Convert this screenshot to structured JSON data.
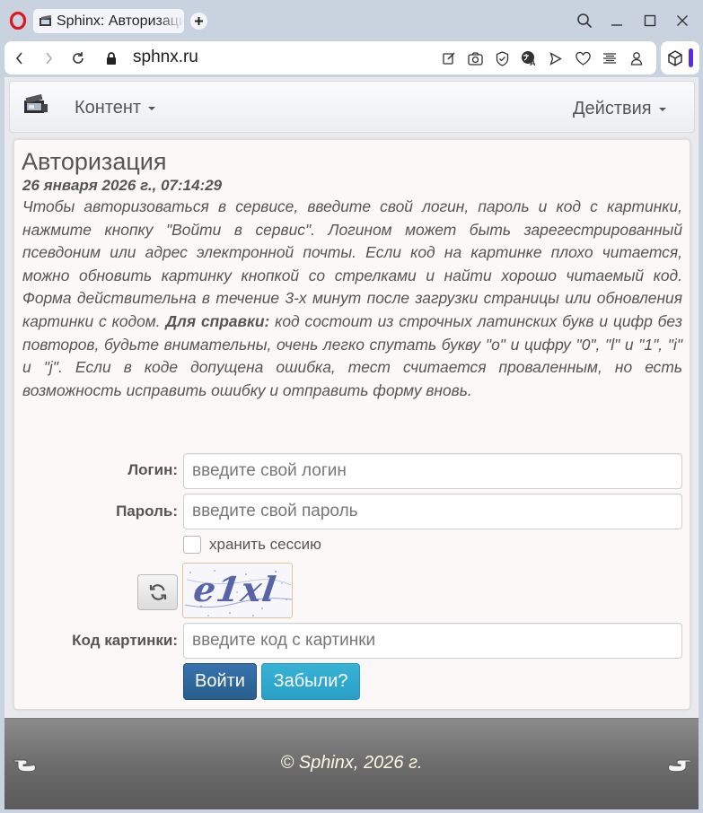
{
  "browser": {
    "tab_title": "Sphinx: Авторизация",
    "url": "sphnx.ru"
  },
  "nav": {
    "content_menu": "Контент",
    "actions_menu": "Действия"
  },
  "auth": {
    "title": "Авторизация",
    "datetime": "26 января 2026 г., 07:14:29",
    "desc_part1": "Чтобы авторизоваться в сервисе, введите свой логин, пароль и код с картинки, нажмите кнопку \"Войти в сервис\". Логином может быть зарегестрированный псевдоним или адрес электронной почты. Если код на картинке плохо читается, можно обновить картинку кнопкой со стрелками и найти хорошо читаемый код. Форма действительна в течение 3-х минут после загрузки страницы или обновления картинки с кодом.",
    "desc_bold": "Для справки:",
    "desc_part2": "код состоит из строчных латинских букв и цифр без повторов, будьте внимательны, очень легко спутать букву \"o\" и цифру \"0\", \"l\" и \"1\", \"i\" и \"j\". Если в коде допущена ошибка, тест считается проваленным, но есть возможность исправить ошибку и отправить форму вновь."
  },
  "form": {
    "login_label": "Логин:",
    "login_placeholder": "введите свой логин",
    "password_label": "Пароль:",
    "password_placeholder": "введите свой пароль",
    "remember_label": "хранить сессию",
    "captcha_text": "e1xl",
    "captcha_label": "Код картинки:",
    "captcha_placeholder": "введите код с картинки",
    "submit_label": "Войти",
    "forgot_label": "Забыли?"
  },
  "footer": {
    "copyright": "© Sphinx, 2026 г."
  }
}
